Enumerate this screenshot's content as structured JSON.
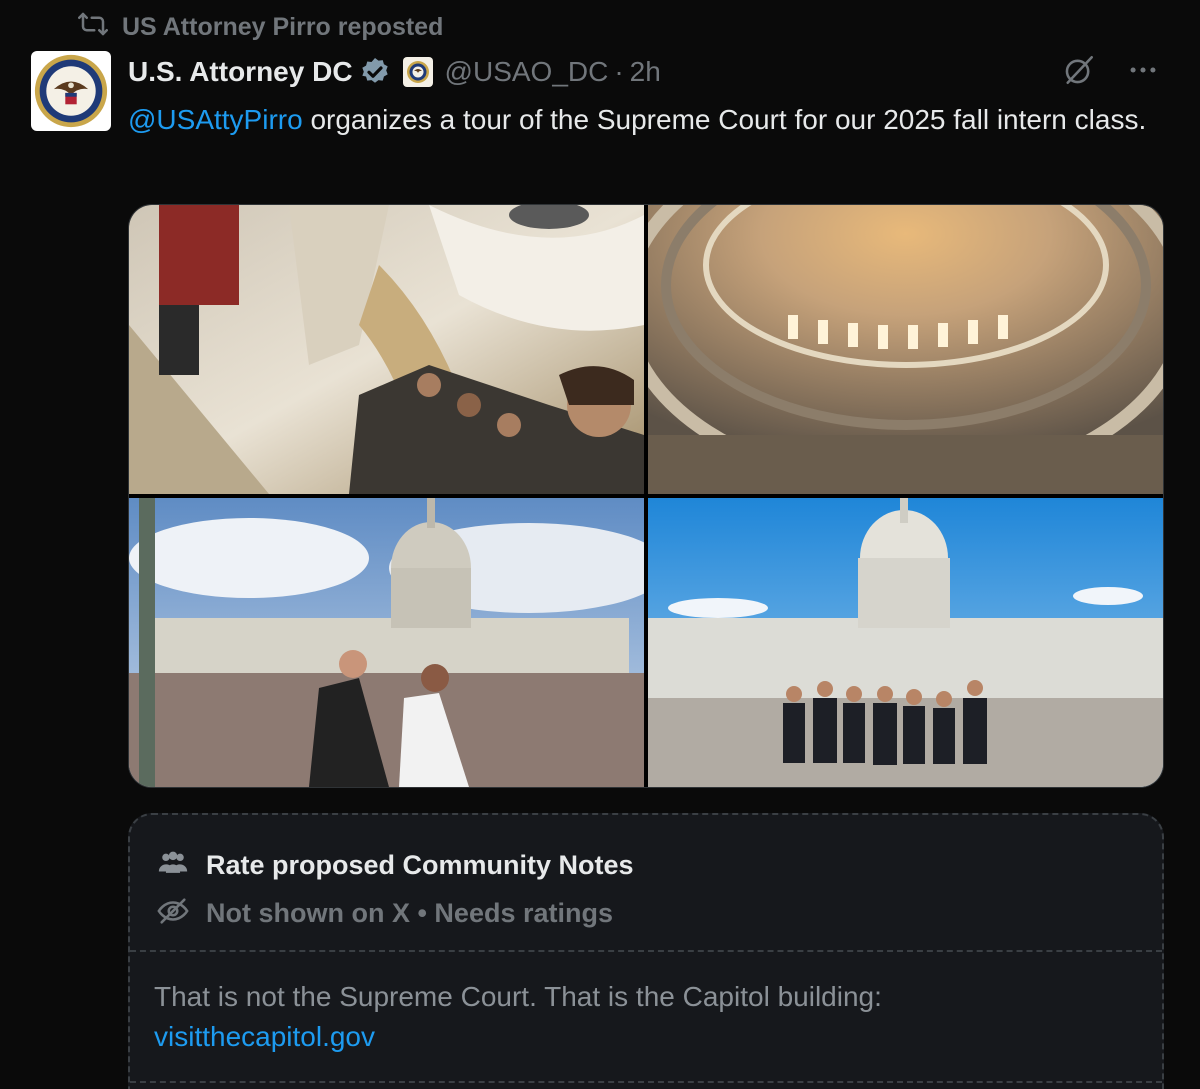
{
  "repost": {
    "label": "US Attorney Pirro reposted",
    "icon": "repost-icon"
  },
  "post": {
    "display_name": "U.S. Attorney DC",
    "handle": "@USAO_DC",
    "separator": "·",
    "time": "2h",
    "verified_color": "#829aab",
    "mention": "@USAttyPirro",
    "text": " organizes a tour of the Supreme Court for our 2025 fall intern class.",
    "accent_color": "#1d9bf0"
  },
  "media": [
    {
      "name": "photo-capitol-hallway"
    },
    {
      "name": "photo-capitol-rotunda"
    },
    {
      "name": "photo-capitol-exterior-two-women"
    },
    {
      "name": "photo-capitol-exterior-group"
    }
  ],
  "community_notes": {
    "title": "Rate proposed Community Notes",
    "status": "Not shown on X • Needs ratings",
    "note_text": "That is not the Supreme Court. That is the Capitol building:",
    "note_link": "visitthecapitol.gov"
  }
}
